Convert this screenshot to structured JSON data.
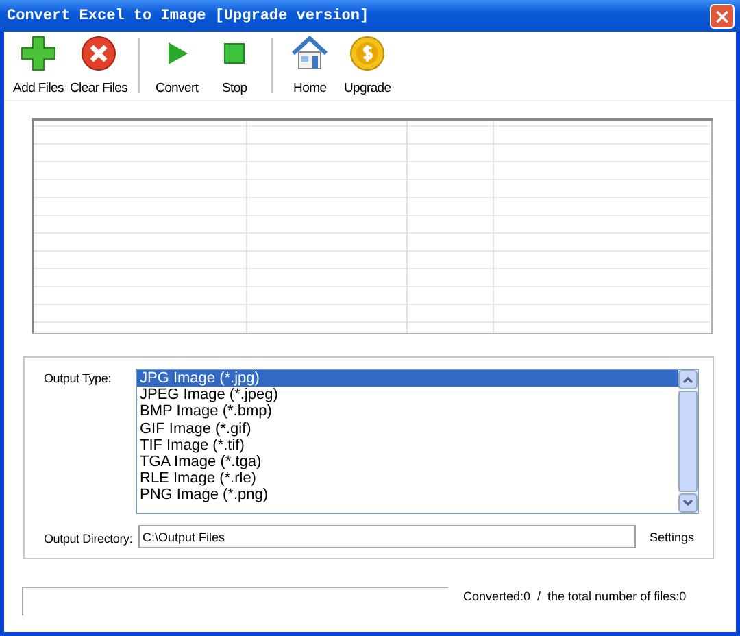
{
  "window": {
    "title": "Convert Excel to Image [Upgrade version]",
    "close": "×"
  },
  "toolbar": [
    {
      "kind": "add",
      "label": "Add Files"
    },
    {
      "kind": "clear",
      "label": "Clear Files"
    },
    {
      "kind": "sep"
    },
    {
      "kind": "play",
      "label": "Convert"
    },
    {
      "kind": "stop",
      "label": "Stop"
    },
    {
      "kind": "sep"
    },
    {
      "kind": "home",
      "label": "Home"
    },
    {
      "kind": "coin",
      "label": "Upgrade"
    }
  ],
  "options": {
    "output_type_label": "Output Type:",
    "output_types": [
      {
        "label": "JPG Image (*.jpg)",
        "selected": true
      },
      {
        "label": "JPEG Image (*.jpeg)",
        "selected": false
      },
      {
        "label": "BMP Image (*.bmp)",
        "selected": false
      },
      {
        "label": "GIF Image (*.gif)",
        "selected": false
      },
      {
        "label": "TIF Image (*.tif)",
        "selected": false
      },
      {
        "label": "TGA Image (*.tga)",
        "selected": false
      },
      {
        "label": "RLE Image (*.rle)",
        "selected": false
      },
      {
        "label": "PNG Image (*.png)",
        "selected": false
      }
    ],
    "output_directory_label": "Output Directory:",
    "output_directory": "C:\\Output Files",
    "settings": "Settings"
  },
  "status_bar": {
    "progress": {
      "level": 0
    },
    "text": "Converted:0  /  the total number of files:0"
  }
}
